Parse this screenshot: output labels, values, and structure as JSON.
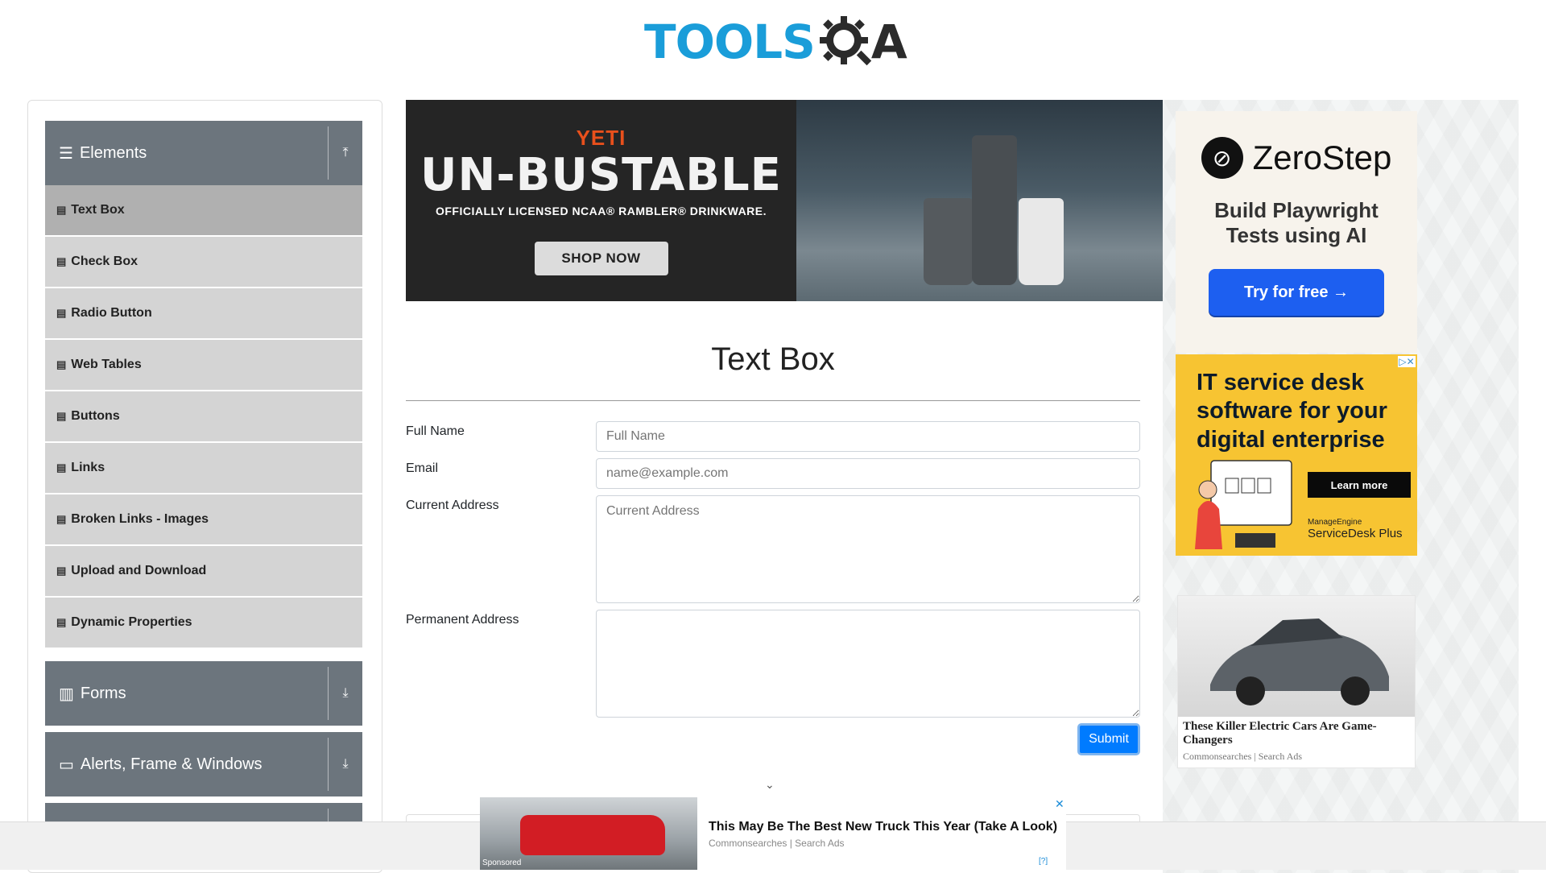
{
  "header": {
    "logo_tools": "TOOLS",
    "logo_qa": "A"
  },
  "sidebar": {
    "groups": [
      {
        "label": "Elements"
      },
      {
        "label": "Forms"
      },
      {
        "label": "Alerts, Frame & Windows"
      }
    ],
    "items": [
      {
        "label": "Text Box"
      },
      {
        "label": "Check Box"
      },
      {
        "label": "Radio Button"
      },
      {
        "label": "Web Tables"
      },
      {
        "label": "Buttons"
      },
      {
        "label": "Links"
      },
      {
        "label": "Broken Links - Images"
      },
      {
        "label": "Upload and Download"
      },
      {
        "label": "Dynamic Properties"
      }
    ]
  },
  "banner": {
    "brand": "YETI",
    "headline": "UN-BUSTABLE",
    "tagline": "OFFICIALLY LICENSED NCAA® RAMBLER® DRINKWARE.",
    "cta": "SHOP NOW"
  },
  "main": {
    "title": "Text Box",
    "fields": {
      "full_name": {
        "label": "Full Name",
        "placeholder": "Full Name"
      },
      "email": {
        "label": "Email",
        "placeholder": "name@example.com"
      },
      "current_address": {
        "label": "Current Address",
        "placeholder": "Current Address"
      },
      "permanent_address": {
        "label": "Permanent Address",
        "placeholder": ""
      }
    },
    "submit": "Submit"
  },
  "ads": {
    "zerostep": {
      "brand": "ZeroStep",
      "subtitle_1": "Build Playwright",
      "subtitle_2": "Tests using AI",
      "cta": "Try for free →"
    },
    "it": {
      "line1": "IT service desk",
      "line2": "software for your",
      "line3": "digital enterprise",
      "cta": "Learn more",
      "maker": "ManageEngine",
      "product": "ServiceDesk Plus"
    },
    "car": {
      "title": "These Killer Electric Cars Are Game-Changers",
      "source": "Commonsearches | Search Ads"
    },
    "bottom": {
      "sponsored": "Sponsored",
      "title": "This May Be The Best New Truck This Year (Take A Look)",
      "source": "Commonsearches | Search Ads",
      "help": "[?]"
    }
  },
  "colors": {
    "accent": "#007bff",
    "sidebar_group": "#6c757d",
    "logo_blue": "#1a9dd9"
  }
}
